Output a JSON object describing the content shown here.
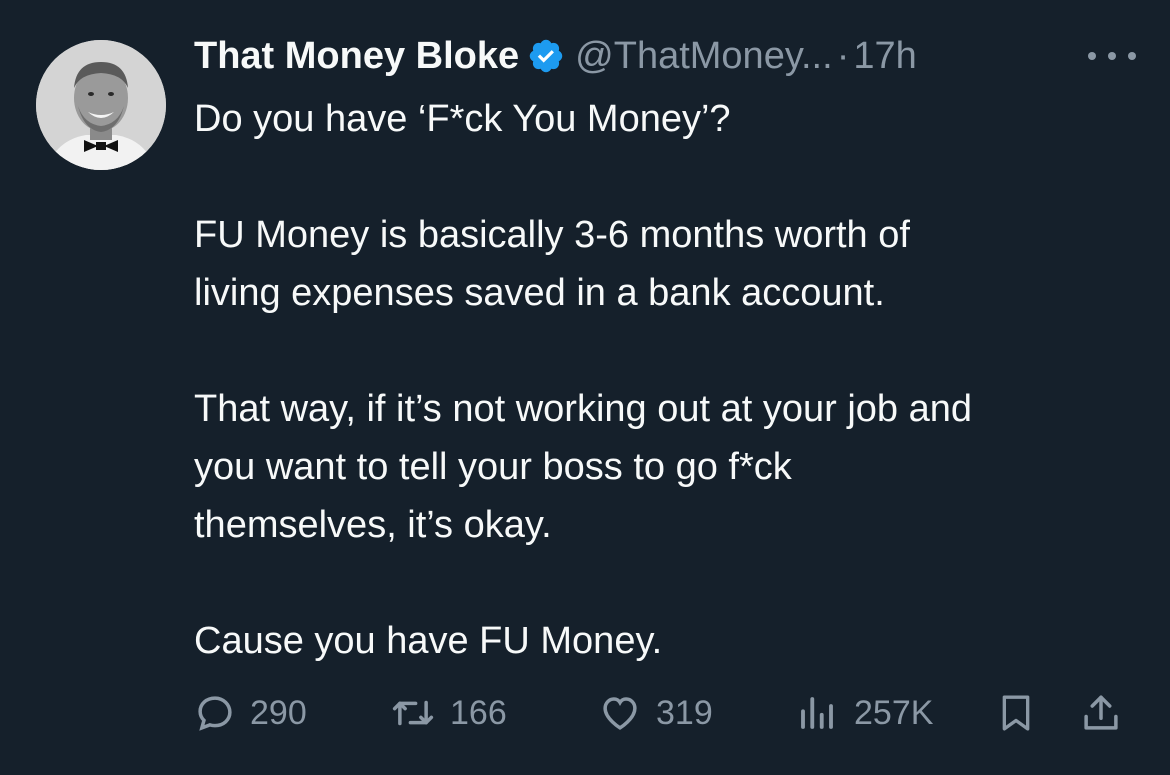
{
  "tweet": {
    "author_name": "That Money Bloke",
    "handle": "@ThatMoney...",
    "separator": "·",
    "time": "17h",
    "lines": [
      "Do you have ‘F*ck You Money’?",
      "",
      "FU Money is basically 3-6 months worth of",
      "living expenses saved in a bank account.",
      "",
      "That way, if it’s not working out at your job and",
      "you want to tell your boss to go f*ck",
      "themselves, it’s okay.",
      "",
      "Cause you have FU Money."
    ]
  },
  "actions": {
    "replies": "290",
    "retweets": "166",
    "likes": "319",
    "views": "257K"
  },
  "icons": {
    "verified": "verified-badge-icon",
    "more": "more-dots-icon",
    "reply": "reply-bubble-icon",
    "retweet": "retweet-icon",
    "like": "heart-icon",
    "views": "views-bar-chart-icon",
    "bookmark": "bookmark-icon",
    "share": "share-upload-icon"
  },
  "colors": {
    "background": "#15202b",
    "text": "#f7f9f9",
    "muted": "#8b98a5",
    "verified": "#1d9bf0"
  }
}
